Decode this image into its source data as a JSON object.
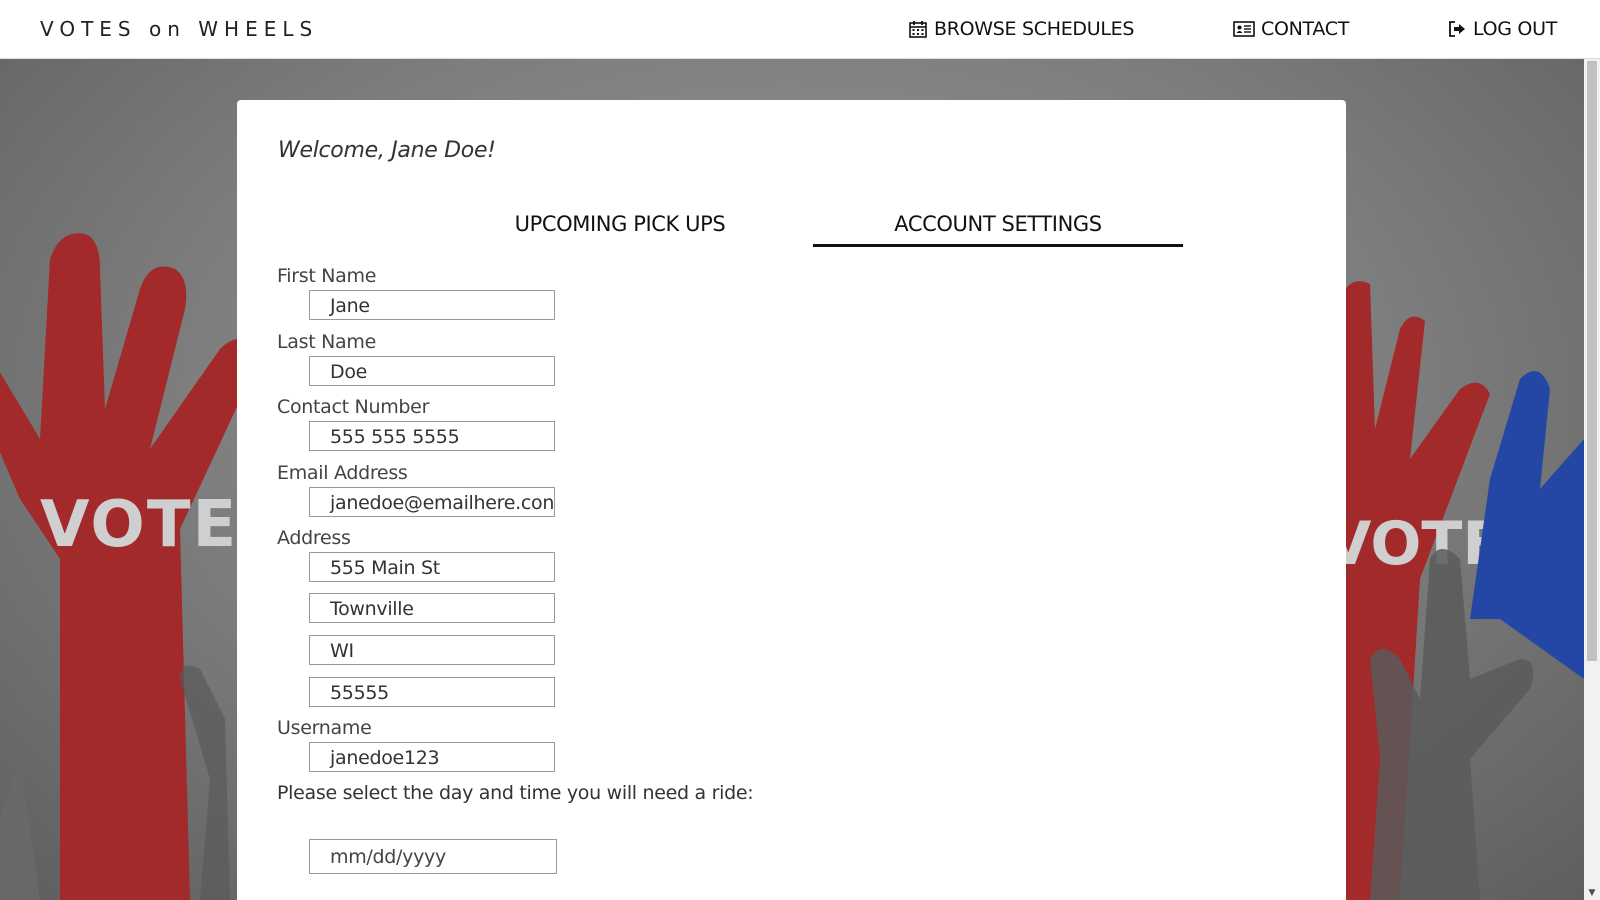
{
  "nav": {
    "brand": "VOTES on WHEELS",
    "browse": {
      "label": "BROWSE SCHEDULES",
      "icon": "calendar-icon"
    },
    "contact": {
      "label": "CONTACT",
      "icon": "contact-card-icon"
    },
    "logout": {
      "label": "LOG OUT",
      "icon": "logout-icon"
    }
  },
  "background": {
    "poster_text": [
      "VOTE",
      "VOTE"
    ],
    "colors": {
      "red": "#a32a2a",
      "blue": "#2447a6",
      "grey": "#5a5a5a"
    }
  },
  "card": {
    "welcome": "Welcome, Jane Doe!",
    "tabs": [
      {
        "label": "UPCOMING PICK UPS",
        "active": false
      },
      {
        "label": "ACCOUNT SETTINGS",
        "active": true
      }
    ],
    "form": {
      "first_name": {
        "label": "First Name",
        "value": "Jane"
      },
      "last_name": {
        "label": "Last Name",
        "value": "Doe"
      },
      "contact": {
        "label": "Contact Number",
        "value": "555 555 5555"
      },
      "email": {
        "label": "Email Address",
        "value": "janedoe@emailhere.con"
      },
      "address": {
        "label": "Address",
        "street": "555 Main St",
        "city": "Townville",
        "state": "WI",
        "zip": "55555"
      },
      "username": {
        "label": "Username",
        "value": "janedoe123"
      },
      "ride_prompt": "Please select the day and time you will need a ride:",
      "date_placeholder": "mm/dd/yyyy"
    }
  }
}
